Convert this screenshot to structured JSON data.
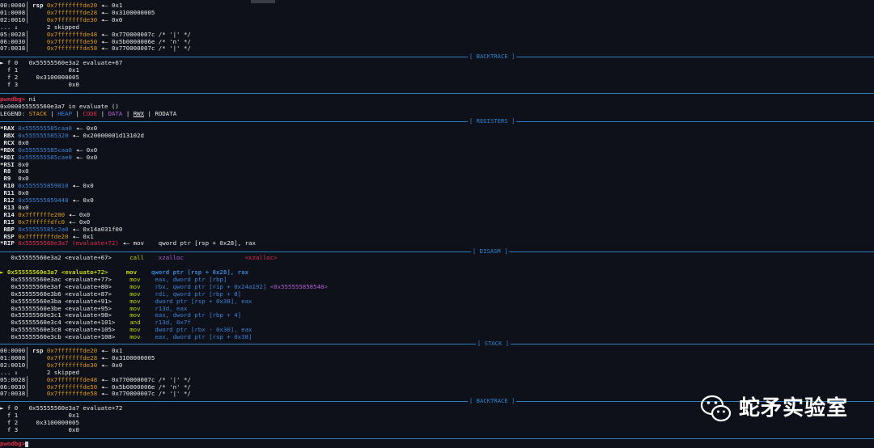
{
  "stack1": [
    [
      "00:0000│ ",
      "rsp ",
      "0x7fffffffde20",
      " ◂— 0x1"
    ],
    [
      "01:0008│     ",
      "",
      "0x7fffffffde28",
      " ◂— 0x3100000005"
    ],
    [
      "02:0010│     ",
      "",
      "0x7fffffffde30",
      " ◂— 0x0"
    ],
    [
      "... ↓        ",
      "",
      "",
      "2 skipped"
    ],
    [
      "05:0028│     ",
      "",
      "0x7fffffffde48",
      " ◂— 0x770000007c /* '|' */"
    ],
    [
      "06:0030│     ",
      "",
      "0x7fffffffde50",
      " ◂— 0x5b0000006e /* 'n' */"
    ],
    [
      "07:0038│     ",
      "",
      "0x7fffffffde58",
      " ◂— 0x770000007c /* '|' */"
    ]
  ],
  "backtrace_label": "[ BACKTRACE ]",
  "backtrace1": [
    "► f 0   0x55555560e3a2 evaluate+67",
    "  f 1              0x1",
    "  f 2     0x3100000005",
    "  f 3              0x0"
  ],
  "prompt": "pwndbg>",
  "cmd": " ni",
  "location": "0x000055555560e3a7 in evaluate ()",
  "legend_prefix": "LEGEND: ",
  "legend": [
    "STACK",
    " | ",
    "HEAP",
    " | ",
    "CODE",
    " | ",
    "DATA",
    " | ",
    "RWX",
    " | RODATA"
  ],
  "registers_label": "[ REGISTERS ]",
  "registers": [
    [
      "*RAX ",
      "0x555555585caa0",
      " ◂— 0x0",
      "blue"
    ],
    [
      " RBX ",
      "0x555555585320",
      " ◂— 0x20000001d13102d",
      "blue"
    ],
    [
      " RCX ",
      "",
      "0x0",
      ""
    ],
    [
      "*RDX ",
      "0x555555585caa0",
      " ◂— 0x0",
      "blue"
    ],
    [
      "*RDI ",
      "0x555555585cae0",
      " ◂— 0x0",
      "blue"
    ],
    [
      "*RSI ",
      "",
      "0x0",
      ""
    ],
    [
      " R8  ",
      "",
      "0x0",
      ""
    ],
    [
      " R9  ",
      "",
      "0x0",
      ""
    ],
    [
      " R10 ",
      "0x555555859010",
      " ◂— 0x0",
      "blue"
    ],
    [
      " R11 ",
      "",
      "0x0",
      ""
    ],
    [
      " R12 ",
      "0x555555859448",
      " ◂— 0x0",
      "blue"
    ],
    [
      " R13 ",
      "",
      "0x0",
      ""
    ],
    [
      " R14 ",
      "0x7ffffffe200",
      " ◂— 0x0",
      "orange"
    ],
    [
      " R15 ",
      "0x7ffffffdfc0",
      " ◂— 0x0",
      "orange"
    ],
    [
      " RBP ",
      "0x55555585c2a0",
      " ◂— 0x14a031f00",
      "blue"
    ],
    [
      " RSP ",
      "0x7fffffffde20",
      " ◂— 0x1",
      "orange"
    ],
    [
      "*RIP ",
      "0x55555560e3a7 (evaluate+72)",
      " ◂— mov    qword ptr [rsp + 0x28], rax",
      "red"
    ]
  ],
  "disasm_label": "[ DISASM ]",
  "disasm_prev": [
    "   0x55555560e3a2 <evaluate+67>     ",
    "call",
    "    xzalloc",
    "                 <xzalloc>"
  ],
  "disasm": [
    [
      "► 0x55555560e3a7 <evaluate+72>     ",
      "mov",
      "    qword ptr [rsp + 0x28], rax",
      ""
    ],
    [
      "   0x55555560e3ac <evaluate+77>     ",
      "mov",
      "    eax, dword ptr [rbp]",
      ""
    ],
    [
      "   0x55555560e3af <evaluate+80>     ",
      "mov",
      "    rbx, qword ptr [rip + 0x24a192]",
      " <0x555555858548>"
    ],
    [
      "   0x55555560e3b6 <evaluate+87>     ",
      "mov",
      "    rdi, qword ptr [rbp + 8]",
      ""
    ],
    [
      "   0x55555560e3ba <evaluate+91>     ",
      "mov",
      "    dword ptr [rsp + 0x38], eax",
      ""
    ],
    [
      "   0x55555560e3be <evaluate+95>     ",
      "mov",
      "    r13d, eax",
      ""
    ],
    [
      "   0x55555560e3c1 <evaluate+98>     ",
      "mov",
      "    eax, dword ptr [rbp + 4]",
      ""
    ],
    [
      "   0x55555560e3c4 <evaluate+101>    ",
      "and",
      "    r13d, 0x7f",
      ""
    ],
    [
      "   0x55555560e3c8 <evaluate+105>    ",
      "mov",
      "    dword ptr [rbx - 0x30], eax",
      ""
    ],
    [
      "   0x55555560e3cb <evaluate+108>    ",
      "mov",
      "    eax, dword ptr [rsp + 0x38]",
      ""
    ]
  ],
  "stack_label": "[ STACK ]",
  "stack2": [
    [
      "00:0000│ ",
      "rsp ",
      "0x7fffffffde20",
      " ◂— 0x1"
    ],
    [
      "01:0008│     ",
      "",
      "0x7fffffffde28",
      " ◂— 0x3100000005"
    ],
    [
      "02:0010│     ",
      "",
      "0x7fffffffde30",
      " ◂— 0x0"
    ],
    [
      "... ↓        ",
      "",
      "",
      "2 skipped"
    ],
    [
      "05:0028│     ",
      "",
      "0x7fffffffde48",
      " ◂— 0x770000007c /* '|' */"
    ],
    [
      "06:0030│     ",
      "",
      "0x7fffffffde50",
      " ◂— 0x5b0000006e /* 'n' */"
    ],
    [
      "07:0038│     ",
      "",
      "0x7fffffffde58",
      " ◂— 0x770000007c /* '|' */"
    ]
  ],
  "backtrace2": [
    "► f 0   0x55555560e3a7 evaluate+72",
    "  f 1              0x1",
    "  f 2     0x3100000005",
    "  f 3              0x0"
  ],
  "watermark": "蛇矛实验室",
  "wm_icon": "wechat-icon"
}
